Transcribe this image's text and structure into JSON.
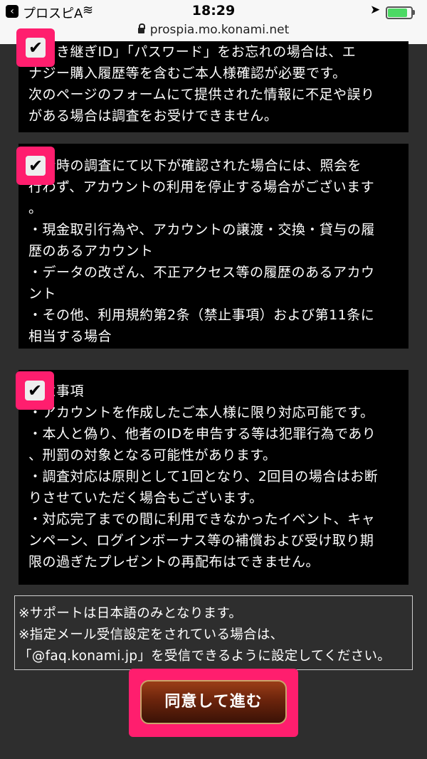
{
  "status_bar": {
    "app": "プロスピA",
    "time": "18:29",
    "url": "prospia.mo.konami.net",
    "battery_level": 0.85
  },
  "sections": [
    {
      "lines": [
        "「引き継ぎID」「パスワード」をお忘れの場合は、エ",
        "ナジー購入履歴等を含むご本人様確認が必要です。",
        "次のページのフォームにて提供された情報に不足や誤り",
        "がある場合は調査をお受けできません。"
      ]
    },
    {
      "lines": [
        "照会時の調査にて以下が確認された場合には、照会を",
        "行わず、アカウントの利用を停止する場合がございます",
        "。",
        "・現金取引行為や、アカウントの譲渡・交換・貸与の履",
        "歴のあるアカウント",
        "・データの改ざん、不正アクセス等の履歴のあるアカウ",
        "ント",
        "・その他、利用規約第2条（禁止事項）および第11条に",
        "相当する場合"
      ]
    },
    {
      "lines": [
        "注意事項",
        "・アカウントを作成したご本人様に限り対応可能です。",
        "・本人と偽り、他者のIDを申告する等は犯罪行為であり",
        "、刑罰の対象となる可能性があります。",
        "・調査対応は原則として1回となり、2回目の場合はお断",
        "りさせていただく場合もございます。",
        "・対応完了までの間に利用できなかったイベント、キャ",
        "ンペーン、ログインボーナス等の補償および受け取り期",
        "限の過ぎたプレゼントの再配布はできません。"
      ]
    }
  ],
  "checkbox_glyph": "✔",
  "notice_lines": [
    "※サポートは日本語のみとなります。",
    "※指定メール受信設定をされている場合は、",
    "「@faq.konami.jp」を受信できるように設定してください。"
  ],
  "agree_button": "同意して進む",
  "colors": {
    "highlight": "#ff1e6e",
    "panel": "#000000",
    "background": "#2e2e2e"
  }
}
